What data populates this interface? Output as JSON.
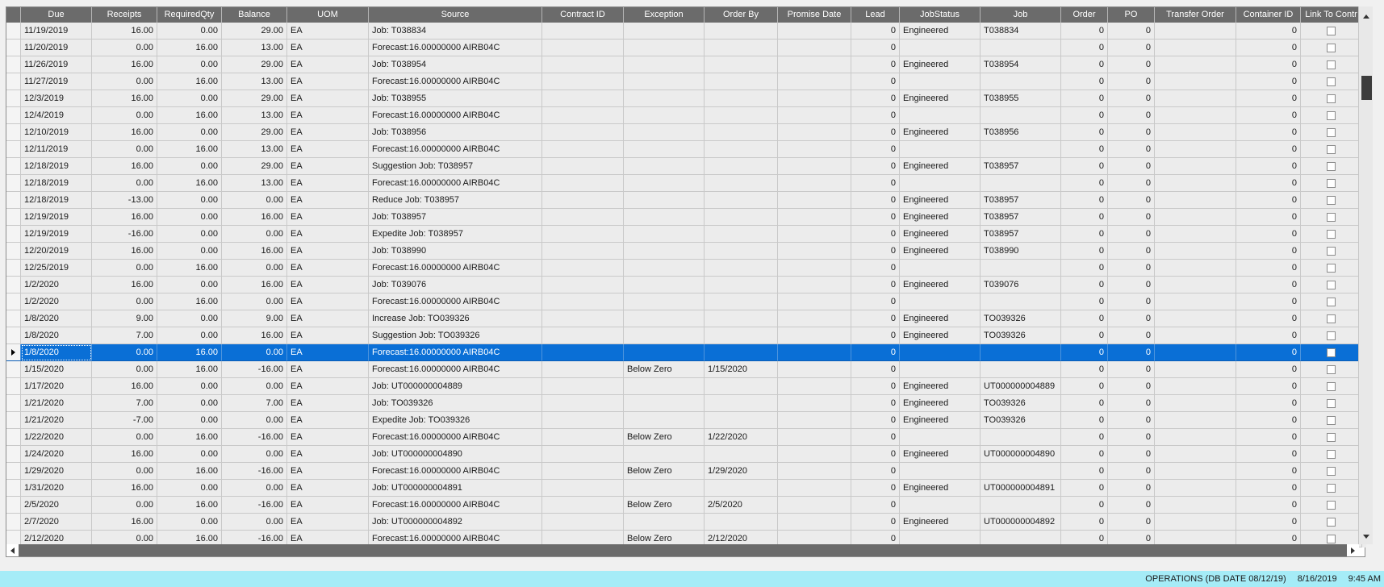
{
  "grid": {
    "columns": [
      {
        "key": "due",
        "label": "Due",
        "align": "left"
      },
      {
        "key": "receipts",
        "label": "Receipts",
        "align": "right"
      },
      {
        "key": "required_qty",
        "label": "RequiredQty",
        "align": "right"
      },
      {
        "key": "balance",
        "label": "Balance",
        "align": "right"
      },
      {
        "key": "uom",
        "label": "UOM",
        "align": "left"
      },
      {
        "key": "source",
        "label": "Source",
        "align": "left"
      },
      {
        "key": "contract_id",
        "label": "Contract ID",
        "align": "left"
      },
      {
        "key": "exception",
        "label": "Exception",
        "align": "left"
      },
      {
        "key": "order_by",
        "label": "Order By",
        "align": "left"
      },
      {
        "key": "promise_date",
        "label": "Promise Date",
        "align": "left"
      },
      {
        "key": "lead",
        "label": "Lead",
        "align": "right"
      },
      {
        "key": "job_status",
        "label": "JobStatus",
        "align": "left"
      },
      {
        "key": "job",
        "label": "Job",
        "align": "left"
      },
      {
        "key": "order",
        "label": "Order",
        "align": "right"
      },
      {
        "key": "po",
        "label": "PO",
        "align": "right"
      },
      {
        "key": "transfer_order",
        "label": "Transfer Order",
        "align": "left"
      },
      {
        "key": "container_id",
        "label": "Container ID",
        "align": "right"
      },
      {
        "key": "link_to_contract",
        "label": "Link To Contr",
        "align": "center"
      }
    ],
    "selected_row": 19,
    "rows": [
      {
        "due": "11/19/2019",
        "receipts": "16.00",
        "required_qty": "0.00",
        "balance": "29.00",
        "uom": "EA",
        "source": "Job: T038834",
        "contract_id": "",
        "exception": "",
        "order_by": "",
        "promise_date": "",
        "lead": "0",
        "job_status": "Engineered",
        "job": "T038834",
        "order": "0",
        "po": "0",
        "transfer_order": "",
        "container_id": "0",
        "link_to_contract": false
      },
      {
        "due": "11/20/2019",
        "receipts": "0.00",
        "required_qty": "16.00",
        "balance": "13.00",
        "uom": "EA",
        "source": "Forecast:16.00000000 AIRB04C",
        "contract_id": "",
        "exception": "",
        "order_by": "",
        "promise_date": "",
        "lead": "0",
        "job_status": "",
        "job": "",
        "order": "0",
        "po": "0",
        "transfer_order": "",
        "container_id": "0",
        "link_to_contract": false
      },
      {
        "due": "11/26/2019",
        "receipts": "16.00",
        "required_qty": "0.00",
        "balance": "29.00",
        "uom": "EA",
        "source": "Job: T038954",
        "contract_id": "",
        "exception": "",
        "order_by": "",
        "promise_date": "",
        "lead": "0",
        "job_status": "Engineered",
        "job": "T038954",
        "order": "0",
        "po": "0",
        "transfer_order": "",
        "container_id": "0",
        "link_to_contract": false
      },
      {
        "due": "11/27/2019",
        "receipts": "0.00",
        "required_qty": "16.00",
        "balance": "13.00",
        "uom": "EA",
        "source": "Forecast:16.00000000 AIRB04C",
        "contract_id": "",
        "exception": "",
        "order_by": "",
        "promise_date": "",
        "lead": "0",
        "job_status": "",
        "job": "",
        "order": "0",
        "po": "0",
        "transfer_order": "",
        "container_id": "0",
        "link_to_contract": false
      },
      {
        "due": "12/3/2019",
        "receipts": "16.00",
        "required_qty": "0.00",
        "balance": "29.00",
        "uom": "EA",
        "source": "Job: T038955",
        "contract_id": "",
        "exception": "",
        "order_by": "",
        "promise_date": "",
        "lead": "0",
        "job_status": "Engineered",
        "job": "T038955",
        "order": "0",
        "po": "0",
        "transfer_order": "",
        "container_id": "0",
        "link_to_contract": false
      },
      {
        "due": "12/4/2019",
        "receipts": "0.00",
        "required_qty": "16.00",
        "balance": "13.00",
        "uom": "EA",
        "source": "Forecast:16.00000000 AIRB04C",
        "contract_id": "",
        "exception": "",
        "order_by": "",
        "promise_date": "",
        "lead": "0",
        "job_status": "",
        "job": "",
        "order": "0",
        "po": "0",
        "transfer_order": "",
        "container_id": "0",
        "link_to_contract": false
      },
      {
        "due": "12/10/2019",
        "receipts": "16.00",
        "required_qty": "0.00",
        "balance": "29.00",
        "uom": "EA",
        "source": "Job: T038956",
        "contract_id": "",
        "exception": "",
        "order_by": "",
        "promise_date": "",
        "lead": "0",
        "job_status": "Engineered",
        "job": "T038956",
        "order": "0",
        "po": "0",
        "transfer_order": "",
        "container_id": "0",
        "link_to_contract": false
      },
      {
        "due": "12/11/2019",
        "receipts": "0.00",
        "required_qty": "16.00",
        "balance": "13.00",
        "uom": "EA",
        "source": "Forecast:16.00000000 AIRB04C",
        "contract_id": "",
        "exception": "",
        "order_by": "",
        "promise_date": "",
        "lead": "0",
        "job_status": "",
        "job": "",
        "order": "0",
        "po": "0",
        "transfer_order": "",
        "container_id": "0",
        "link_to_contract": false
      },
      {
        "due": "12/18/2019",
        "receipts": "16.00",
        "required_qty": "0.00",
        "balance": "29.00",
        "uom": "EA",
        "source": "Suggestion Job: T038957",
        "contract_id": "",
        "exception": "",
        "order_by": "",
        "promise_date": "",
        "lead": "0",
        "job_status": "Engineered",
        "job": "T038957",
        "order": "0",
        "po": "0",
        "transfer_order": "",
        "container_id": "0",
        "link_to_contract": false
      },
      {
        "due": "12/18/2019",
        "receipts": "0.00",
        "required_qty": "16.00",
        "balance": "13.00",
        "uom": "EA",
        "source": "Forecast:16.00000000 AIRB04C",
        "contract_id": "",
        "exception": "",
        "order_by": "",
        "promise_date": "",
        "lead": "0",
        "job_status": "",
        "job": "",
        "order": "0",
        "po": "0",
        "transfer_order": "",
        "container_id": "0",
        "link_to_contract": false
      },
      {
        "due": "12/18/2019",
        "receipts": "-13.00",
        "required_qty": "0.00",
        "balance": "0.00",
        "uom": "EA",
        "source": "Reduce Job: T038957",
        "contract_id": "",
        "exception": "",
        "order_by": "",
        "promise_date": "",
        "lead": "0",
        "job_status": "Engineered",
        "job": "T038957",
        "order": "0",
        "po": "0",
        "transfer_order": "",
        "container_id": "0",
        "link_to_contract": false
      },
      {
        "due": "12/19/2019",
        "receipts": "16.00",
        "required_qty": "0.00",
        "balance": "16.00",
        "uom": "EA",
        "source": "Job: T038957",
        "contract_id": "",
        "exception": "",
        "order_by": "",
        "promise_date": "",
        "lead": "0",
        "job_status": "Engineered",
        "job": "T038957",
        "order": "0",
        "po": "0",
        "transfer_order": "",
        "container_id": "0",
        "link_to_contract": false
      },
      {
        "due": "12/19/2019",
        "receipts": "-16.00",
        "required_qty": "0.00",
        "balance": "0.00",
        "uom": "EA",
        "source": "Expedite Job: T038957",
        "contract_id": "",
        "exception": "",
        "order_by": "",
        "promise_date": "",
        "lead": "0",
        "job_status": "Engineered",
        "job": "T038957",
        "order": "0",
        "po": "0",
        "transfer_order": "",
        "container_id": "0",
        "link_to_contract": false
      },
      {
        "due": "12/20/2019",
        "receipts": "16.00",
        "required_qty": "0.00",
        "balance": "16.00",
        "uom": "EA",
        "source": "Job: T038990",
        "contract_id": "",
        "exception": "",
        "order_by": "",
        "promise_date": "",
        "lead": "0",
        "job_status": "Engineered",
        "job": "T038990",
        "order": "0",
        "po": "0",
        "transfer_order": "",
        "container_id": "0",
        "link_to_contract": false
      },
      {
        "due": "12/25/2019",
        "receipts": "0.00",
        "required_qty": "16.00",
        "balance": "0.00",
        "uom": "EA",
        "source": "Forecast:16.00000000 AIRB04C",
        "contract_id": "",
        "exception": "",
        "order_by": "",
        "promise_date": "",
        "lead": "0",
        "job_status": "",
        "job": "",
        "order": "0",
        "po": "0",
        "transfer_order": "",
        "container_id": "0",
        "link_to_contract": false
      },
      {
        "due": "1/2/2020",
        "receipts": "16.00",
        "required_qty": "0.00",
        "balance": "16.00",
        "uom": "EA",
        "source": "Job: T039076",
        "contract_id": "",
        "exception": "",
        "order_by": "",
        "promise_date": "",
        "lead": "0",
        "job_status": "Engineered",
        "job": "T039076",
        "order": "0",
        "po": "0",
        "transfer_order": "",
        "container_id": "0",
        "link_to_contract": false
      },
      {
        "due": "1/2/2020",
        "receipts": "0.00",
        "required_qty": "16.00",
        "balance": "0.00",
        "uom": "EA",
        "source": "Forecast:16.00000000 AIRB04C",
        "contract_id": "",
        "exception": "",
        "order_by": "",
        "promise_date": "",
        "lead": "0",
        "job_status": "",
        "job": "",
        "order": "0",
        "po": "0",
        "transfer_order": "",
        "container_id": "0",
        "link_to_contract": false
      },
      {
        "due": "1/8/2020",
        "receipts": "9.00",
        "required_qty": "0.00",
        "balance": "9.00",
        "uom": "EA",
        "source": "Increase Job: TO039326",
        "contract_id": "",
        "exception": "",
        "order_by": "",
        "promise_date": "",
        "lead": "0",
        "job_status": "Engineered",
        "job": "TO039326",
        "order": "0",
        "po": "0",
        "transfer_order": "",
        "container_id": "0",
        "link_to_contract": false
      },
      {
        "due": "1/8/2020",
        "receipts": "7.00",
        "required_qty": "0.00",
        "balance": "16.00",
        "uom": "EA",
        "source": "Suggestion Job: TO039326",
        "contract_id": "",
        "exception": "",
        "order_by": "",
        "promise_date": "",
        "lead": "0",
        "job_status": "Engineered",
        "job": "TO039326",
        "order": "0",
        "po": "0",
        "transfer_order": "",
        "container_id": "0",
        "link_to_contract": false
      },
      {
        "due": "1/8/2020",
        "receipts": "0.00",
        "required_qty": "16.00",
        "balance": "0.00",
        "uom": "EA",
        "source": "Forecast:16.00000000 AIRB04C",
        "contract_id": "",
        "exception": "",
        "order_by": "",
        "promise_date": "",
        "lead": "0",
        "job_status": "",
        "job": "",
        "order": "0",
        "po": "0",
        "transfer_order": "",
        "container_id": "0",
        "link_to_contract": false
      },
      {
        "due": "1/15/2020",
        "receipts": "0.00",
        "required_qty": "16.00",
        "balance": "-16.00",
        "uom": "EA",
        "source": "Forecast:16.00000000 AIRB04C",
        "contract_id": "",
        "exception": "Below Zero",
        "order_by": "1/15/2020",
        "promise_date": "",
        "lead": "0",
        "job_status": "",
        "job": "",
        "order": "0",
        "po": "0",
        "transfer_order": "",
        "container_id": "0",
        "link_to_contract": false
      },
      {
        "due": "1/17/2020",
        "receipts": "16.00",
        "required_qty": "0.00",
        "balance": "0.00",
        "uom": "EA",
        "source": "Job: UT000000004889",
        "contract_id": "",
        "exception": "",
        "order_by": "",
        "promise_date": "",
        "lead": "0",
        "job_status": "Engineered",
        "job": "UT000000004889",
        "order": "0",
        "po": "0",
        "transfer_order": "",
        "container_id": "0",
        "link_to_contract": false
      },
      {
        "due": "1/21/2020",
        "receipts": "7.00",
        "required_qty": "0.00",
        "balance": "7.00",
        "uom": "EA",
        "source": "Job: TO039326",
        "contract_id": "",
        "exception": "",
        "order_by": "",
        "promise_date": "",
        "lead": "0",
        "job_status": "Engineered",
        "job": "TO039326",
        "order": "0",
        "po": "0",
        "transfer_order": "",
        "container_id": "0",
        "link_to_contract": false
      },
      {
        "due": "1/21/2020",
        "receipts": "-7.00",
        "required_qty": "0.00",
        "balance": "0.00",
        "uom": "EA",
        "source": "Expedite Job: TO039326",
        "contract_id": "",
        "exception": "",
        "order_by": "",
        "promise_date": "",
        "lead": "0",
        "job_status": "Engineered",
        "job": "TO039326",
        "order": "0",
        "po": "0",
        "transfer_order": "",
        "container_id": "0",
        "link_to_contract": false
      },
      {
        "due": "1/22/2020",
        "receipts": "0.00",
        "required_qty": "16.00",
        "balance": "-16.00",
        "uom": "EA",
        "source": "Forecast:16.00000000 AIRB04C",
        "contract_id": "",
        "exception": "Below Zero",
        "order_by": "1/22/2020",
        "promise_date": "",
        "lead": "0",
        "job_status": "",
        "job": "",
        "order": "0",
        "po": "0",
        "transfer_order": "",
        "container_id": "0",
        "link_to_contract": false
      },
      {
        "due": "1/24/2020",
        "receipts": "16.00",
        "required_qty": "0.00",
        "balance": "0.00",
        "uom": "EA",
        "source": "Job: UT000000004890",
        "contract_id": "",
        "exception": "",
        "order_by": "",
        "promise_date": "",
        "lead": "0",
        "job_status": "Engineered",
        "job": "UT000000004890",
        "order": "0",
        "po": "0",
        "transfer_order": "",
        "container_id": "0",
        "link_to_contract": false
      },
      {
        "due": "1/29/2020",
        "receipts": "0.00",
        "required_qty": "16.00",
        "balance": "-16.00",
        "uom": "EA",
        "source": "Forecast:16.00000000 AIRB04C",
        "contract_id": "",
        "exception": "Below Zero",
        "order_by": "1/29/2020",
        "promise_date": "",
        "lead": "0",
        "job_status": "",
        "job": "",
        "order": "0",
        "po": "0",
        "transfer_order": "",
        "container_id": "0",
        "link_to_contract": false
      },
      {
        "due": "1/31/2020",
        "receipts": "16.00",
        "required_qty": "0.00",
        "balance": "0.00",
        "uom": "EA",
        "source": "Job: UT000000004891",
        "contract_id": "",
        "exception": "",
        "order_by": "",
        "promise_date": "",
        "lead": "0",
        "job_status": "Engineered",
        "job": "UT000000004891",
        "order": "0",
        "po": "0",
        "transfer_order": "",
        "container_id": "0",
        "link_to_contract": false
      },
      {
        "due": "2/5/2020",
        "receipts": "0.00",
        "required_qty": "16.00",
        "balance": "-16.00",
        "uom": "EA",
        "source": "Forecast:16.00000000 AIRB04C",
        "contract_id": "",
        "exception": "Below Zero",
        "order_by": "2/5/2020",
        "promise_date": "",
        "lead": "0",
        "job_status": "",
        "job": "",
        "order": "0",
        "po": "0",
        "transfer_order": "",
        "container_id": "0",
        "link_to_contract": false
      },
      {
        "due": "2/7/2020",
        "receipts": "16.00",
        "required_qty": "0.00",
        "balance": "0.00",
        "uom": "EA",
        "source": "Job: UT000000004892",
        "contract_id": "",
        "exception": "",
        "order_by": "",
        "promise_date": "",
        "lead": "0",
        "job_status": "Engineered",
        "job": "UT000000004892",
        "order": "0",
        "po": "0",
        "transfer_order": "",
        "container_id": "0",
        "link_to_contract": false
      },
      {
        "due": "2/12/2020",
        "receipts": "0.00",
        "required_qty": "16.00",
        "balance": "-16.00",
        "uom": "EA",
        "source": "Forecast:16.00000000 AIRB04C",
        "contract_id": "",
        "exception": "Below Zero",
        "order_by": "2/12/2020",
        "promise_date": "",
        "lead": "0",
        "job_status": "",
        "job": "",
        "order": "0",
        "po": "0",
        "transfer_order": "",
        "container_id": "0",
        "link_to_contract": false
      }
    ]
  },
  "status_bar": {
    "company": "OPERATIONS (DB DATE 08/12/19)",
    "date": "8/16/2019",
    "time": "9:45 AM"
  },
  "colors": {
    "header_bg": "#6b6b6b",
    "row_bg": "#ececec",
    "selected_bg": "#0a6fd6",
    "status_bar_bg": "#a5ecf7"
  }
}
